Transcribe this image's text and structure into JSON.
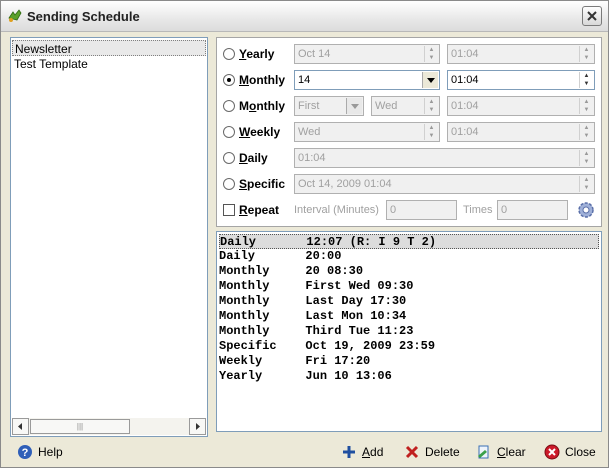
{
  "window": {
    "title": "Sending Schedule"
  },
  "templates": [
    "Newsletter",
    "Test Template"
  ],
  "schedule": {
    "yearly": {
      "label_pre": "",
      "label_key": "Y",
      "label_post": "early",
      "date": "Oct 14",
      "time": "01:04"
    },
    "monthly1": {
      "label_pre": "",
      "label_key": "M",
      "label_post": "onthly",
      "day": "14",
      "time": "01:04"
    },
    "monthly2": {
      "label_pre": "M",
      "label_key": "o",
      "label_post": "nthly",
      "week": "First",
      "weekday": "Wed",
      "time": "01:04"
    },
    "weekly": {
      "label_pre": "",
      "label_key": "W",
      "label_post": "eekly",
      "weekday": "Wed",
      "time": "01:04"
    },
    "daily": {
      "label_pre": "",
      "label_key": "D",
      "label_post": "aily",
      "time": "01:04"
    },
    "specific": {
      "label_pre": "",
      "label_key": "S",
      "label_post": "pecific",
      "datetime": "Oct 14, 2009 01:04"
    },
    "repeat": {
      "label_pre": "",
      "label_key": "R",
      "label_post": "epeat",
      "interval_label": "Interval (Minutes)",
      "interval_value": "0",
      "times_label": "Times",
      "times_value": "0"
    }
  },
  "entries": [
    "Daily       12:07 (R: I 9 T 2)",
    "Daily       20:00",
    "Monthly     20 08:30",
    "Monthly     First Wed 09:30",
    "Monthly     Last Day 17:30",
    "Monthly     Last Mon 10:34",
    "Monthly     Third Tue 11:23",
    "Specific    Oct 19, 2009 23:59",
    "Weekly      Fri 17:20",
    "Yearly      Jun 10 13:06"
  ],
  "buttons": {
    "help": "Help",
    "add_key": "A",
    "add_rest": "dd",
    "delete": "Delete",
    "clear_key": "C",
    "clear_rest": "lear",
    "close": "Close"
  },
  "colors": {
    "accent": "#1f4fa0",
    "delete": "#c0201f",
    "close": "#cc1a2a"
  }
}
